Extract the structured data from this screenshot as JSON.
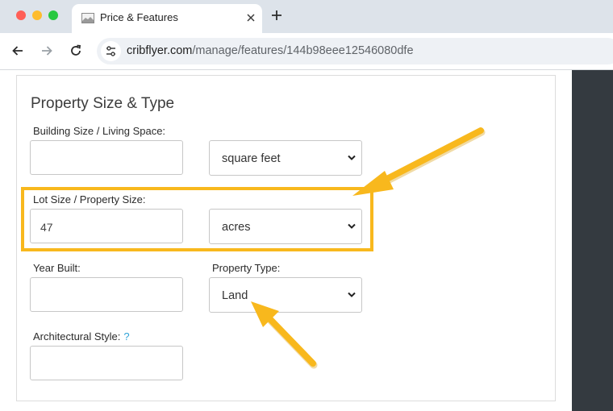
{
  "browser": {
    "tab_title": "Price & Features",
    "url_domain": "cribflyer.com",
    "url_path": "/manage/features/144b98eee12546080dfe"
  },
  "form": {
    "section_title": "Property Size & Type",
    "building_size": {
      "label": "Building Size / Living Space:",
      "value": "",
      "unit": "square feet"
    },
    "lot_size": {
      "label": "Lot Size / Property Size:",
      "value": "47",
      "unit": "acres"
    },
    "year_built": {
      "label": "Year Built:",
      "value": ""
    },
    "property_type": {
      "label": "Property Type:",
      "value": "Land"
    },
    "architectural_style": {
      "label": "Architectural Style:",
      "help": "?",
      "value": ""
    }
  },
  "colors": {
    "annotation": "#f8b81d",
    "sidebar": "#343a40",
    "help": "#2fa3d8"
  }
}
